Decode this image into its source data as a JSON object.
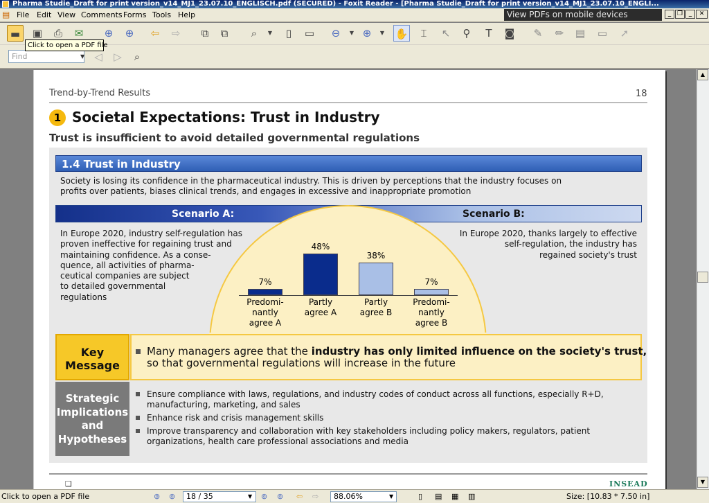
{
  "window": {
    "title": "Pharma Studie_Draft for print version_v14_MJ1_23.07.10_ENGLISCH.pdf (SECURED) - Foxit Reader - [Pharma Studie_Draft for print version_v14_MJ1_23.07.10_ENGLI...",
    "promo": "View PDFs on mobile devices"
  },
  "menu": [
    "File",
    "Edit",
    "View",
    "Comments",
    "Forms",
    "Tools",
    "Help"
  ],
  "tooltip": "Click to open a PDF file",
  "find": {
    "placeholder": "Find"
  },
  "statusbar": {
    "message": "Click to open a PDF file",
    "page": "18 / 35",
    "zoom": "88.06%",
    "size": "Size: [10.83 * 7.50 in]"
  },
  "page": {
    "header": "Trend-by-Trend Results",
    "number": "18",
    "badge": "1",
    "title": "Societal Expectations: Trust in Industry",
    "subtitle": "Trust is insufficient to avoid detailed governmental regulations",
    "section_title": "1.4 Trust in Industry",
    "section_desc": [
      "Society is losing its confidence in the pharmaceutical industry. This is driven by perceptions that the industry focuses on",
      "profits over patients, biases clinical trends, and engages in excessive and inappropriate promotion"
    ],
    "scenario_a": {
      "title": "Scenario A:",
      "text": [
        "In Europe 2020, industry self-regulation has",
        "proven ineffective for regaining trust and",
        "maintaining confidence. As a conse-",
        "quence, all activities of pharma-",
        "ceutical companies are subject",
        "to detailed governmental",
        "regulations"
      ]
    },
    "scenario_b": {
      "title": "Scenario B:",
      "text": [
        "In Europe 2020, thanks largely to effective",
        "self-regulation, the industry has",
        "regained society's trust"
      ]
    },
    "key_message": {
      "label": [
        "Key",
        "Message"
      ],
      "text_pre": "Many managers agree that the ",
      "text_bold": "industry has only limited influence on the society's trust,",
      "text_line2": "so that governmental regulations will increase in the future"
    },
    "strategic": {
      "label": [
        "Strategic",
        "Implications",
        "and",
        "Hypotheses"
      ],
      "items": [
        [
          "Ensure compliance with laws, regulations, and industry codes of conduct across all functions, especially R+D,",
          "manufacturing, marketing, and sales"
        ],
        [
          "Enhance risk and crisis management skills"
        ],
        [
          "Improve transparency and collaboration with key stakeholders including policy makers, regulators, patient",
          "organizations, health care professional associations and media"
        ]
      ]
    },
    "footer_logo": "INSEAD"
  },
  "chart_data": {
    "type": "bar",
    "categories": [
      "Predominantly agree A",
      "Partly agree A",
      "Partly agree B",
      "Predominantly agree B"
    ],
    "category_labels": [
      [
        "Predomi-",
        "nantly",
        "agree A"
      ],
      [
        "Partly",
        "agree A"
      ],
      [
        "Partly",
        "agree B"
      ],
      [
        "Predomi-",
        "nantly",
        "agree B"
      ]
    ],
    "values": [
      7,
      48,
      38,
      7
    ],
    "value_labels": [
      "7%",
      "48%",
      "38%",
      "7%"
    ],
    "colors": [
      "#0a2c8c",
      "#0a2c8c",
      "#a9bfe6",
      "#a9bfe6"
    ],
    "ylim": [
      0,
      50
    ]
  }
}
